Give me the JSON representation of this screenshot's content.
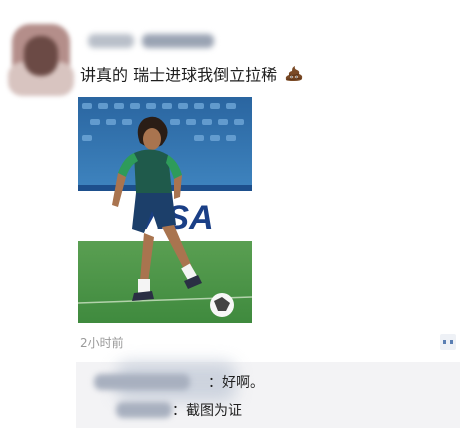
{
  "post": {
    "text": "讲真的 瑞士进球我倒立拉稀",
    "emoji_icon": "poop-icon",
    "time": "2小时前"
  },
  "photo": {
    "banner_text": "VISA"
  },
  "comments": [
    {
      "text": "：好啊。"
    },
    {
      "text": "：截图为证"
    }
  ],
  "colors": {
    "background": "#ffffff",
    "comment_bg": "#f3f3f5",
    "time_text": "#9a9a9a",
    "stadium_blue": "#2d6ca6",
    "pitch_green": "#4f9b4a",
    "jersey_green": "#2e9b5a",
    "comment_icon": "#5b7fb3"
  }
}
